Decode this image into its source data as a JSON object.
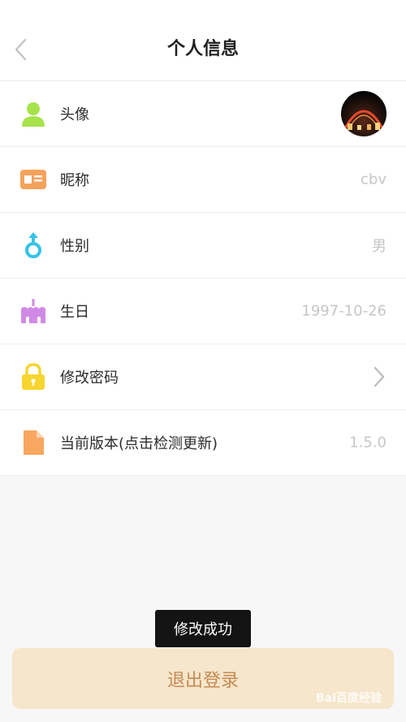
{
  "header": {
    "title": "个人信息",
    "back_icon": "chevron-left-icon"
  },
  "rows": [
    {
      "label": "头像",
      "icon": "user-icon",
      "icon_color": "#a6e34a",
      "value_type": "avatar"
    },
    {
      "label": "昵称",
      "icon": "id-card-icon",
      "icon_color": "#f5a25b",
      "value": "cbv"
    },
    {
      "label": "性别",
      "icon": "gender-icon",
      "icon_color": "#36c3e8",
      "value": "男"
    },
    {
      "label": "生日",
      "icon": "birthday-cake-icon",
      "icon_color": "#d08ae6",
      "value": "1997-10-26"
    },
    {
      "label": "修改密码",
      "icon": "lock-icon",
      "icon_color": "#f7d531",
      "value_type": "chevron"
    },
    {
      "label": "当前版本(点击检测更新)",
      "icon": "document-icon",
      "icon_color": "#f9a661",
      "value": "1.5.0"
    }
  ],
  "toast": {
    "text": "修改成功"
  },
  "logout_button": {
    "label": "退出登录",
    "bg_color": "#f6e6cb",
    "text_color": "#c58a55"
  },
  "watermark": {
    "text": "Bai百度经验"
  }
}
